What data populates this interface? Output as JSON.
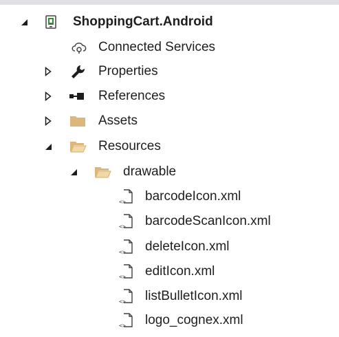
{
  "solution_explorer": {
    "project": {
      "label": "ShoppingCart.Android",
      "expanded": true
    },
    "items": [
      {
        "label": "Connected Services",
        "icon": "cloud-services-icon"
      },
      {
        "label": "Properties",
        "icon": "wrench-icon"
      },
      {
        "label": "References",
        "icon": "references-icon"
      },
      {
        "label": "Assets",
        "icon": "folder-icon"
      },
      {
        "label": "Resources",
        "icon": "folder-open-icon"
      },
      {
        "label": "drawable",
        "icon": "folder-open-icon"
      },
      {
        "label": "barcodeIcon.xml",
        "icon": "xml-file-icon"
      },
      {
        "label": "barcodeScanIcon.xml",
        "icon": "xml-file-icon"
      },
      {
        "label": "deleteIcon.xml",
        "icon": "xml-file-icon"
      },
      {
        "label": "editIcon.xml",
        "icon": "xml-file-icon"
      },
      {
        "label": "listBulletIcon.xml",
        "icon": "xml-file-icon"
      },
      {
        "label": "logo_cognex.xml",
        "icon": "xml-file-icon"
      }
    ]
  },
  "colors": {
    "folder": "#dcb67a",
    "arrow": "#1e1e1e",
    "android_icon": "#388a34"
  }
}
